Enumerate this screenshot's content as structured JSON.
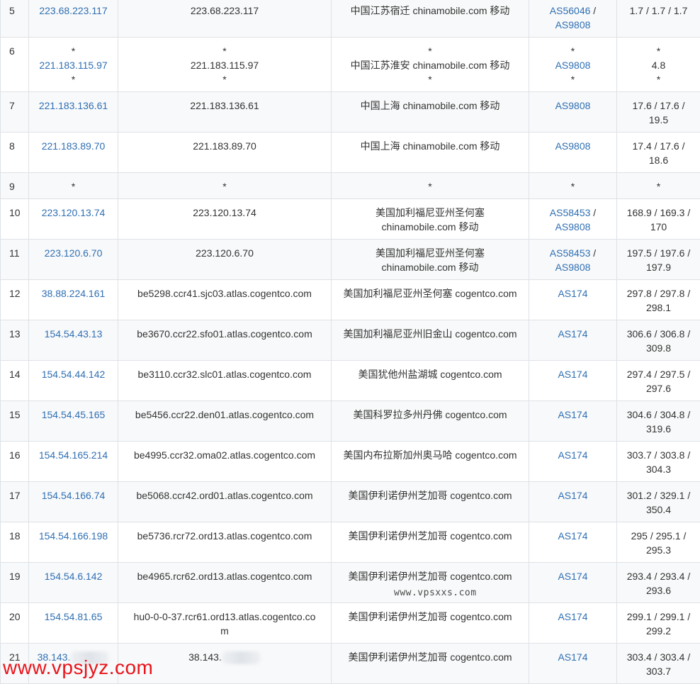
{
  "rows": [
    {
      "num": "5",
      "ip": "223.68.223.117",
      "host": "223.68.223.117",
      "geo": "中国江苏宿迁 chinamobile.com 移动",
      "as": [
        "AS56046",
        "AS9808"
      ],
      "rtt": "1.7 / 1.7 / 1.7"
    },
    {
      "num": "6",
      "ip": "221.183.115.97",
      "host": "221.183.115.97",
      "geo": "中国江苏淮安 chinamobile.com 移动",
      "as": [
        "AS9808"
      ],
      "rtt": "4.8"
    },
    {
      "num": "7",
      "ip": "221.183.136.61",
      "host": "221.183.136.61",
      "geo": "中国上海 chinamobile.com 移动",
      "as": [
        "AS9808"
      ],
      "rtt": "17.6 / 17.6 / 19.5"
    },
    {
      "num": "8",
      "ip": "221.183.89.70",
      "host": "221.183.89.70",
      "geo": "中国上海 chinamobile.com 移动",
      "as": [
        "AS9808"
      ],
      "rtt": "17.4 / 17.6 / 18.6"
    },
    {
      "num": "9",
      "ip": "*",
      "host": "*",
      "geo": "*",
      "as": [
        "*"
      ],
      "rtt": "*"
    },
    {
      "num": "10",
      "ip": "223.120.13.74",
      "host": "223.120.13.74",
      "geo": "美国加利福尼亚州圣何塞 chinamobile.com 移动",
      "as": [
        "AS58453",
        "AS9808"
      ],
      "rtt": "168.9 / 169.3 / 170"
    },
    {
      "num": "11",
      "ip": "223.120.6.70",
      "host": "223.120.6.70",
      "geo": "美国加利福尼亚州圣何塞 chinamobile.com 移动",
      "as": [
        "AS58453",
        "AS9808"
      ],
      "rtt": "197.5 / 197.6 / 197.9"
    },
    {
      "num": "12",
      "ip": "38.88.224.161",
      "host": "be5298.ccr41.sjc03.atlas.cogentco.com",
      "geo": "美国加利福尼亚州圣何塞 cogentco.com",
      "as": [
        "AS174"
      ],
      "rtt": "297.8 / 297.8 / 298.1"
    },
    {
      "num": "13",
      "ip": "154.54.43.13",
      "host": "be3670.ccr22.sfo01.atlas.cogentco.com",
      "geo": "美国加利福尼亚州旧金山 cogentco.com",
      "as": [
        "AS174"
      ],
      "rtt": "306.6 / 306.8 / 309.8"
    },
    {
      "num": "14",
      "ip": "154.54.44.142",
      "host": "be3110.ccr32.slc01.atlas.cogentco.com",
      "geo": "美国犹他州盐湖城 cogentco.com",
      "as": [
        "AS174"
      ],
      "rtt": "297.4 / 297.5 / 297.6"
    },
    {
      "num": "15",
      "ip": "154.54.45.165",
      "host": "be5456.ccr22.den01.atlas.cogentco.com",
      "geo": "美国科罗拉多州丹佛 cogentco.com",
      "as": [
        "AS174"
      ],
      "rtt": "304.6 / 304.8 / 319.6"
    },
    {
      "num": "16",
      "ip": "154.54.165.214",
      "host": "be4995.ccr32.oma02.atlas.cogentco.com",
      "geo": "美国内布拉斯加州奥马哈 cogentco.com",
      "as": [
        "AS174"
      ],
      "rtt": "303.7 / 303.8 / 304.3"
    },
    {
      "num": "17",
      "ip": "154.54.166.74",
      "host": "be5068.ccr42.ord01.atlas.cogentco.com",
      "geo": "美国伊利诺伊州芝加哥 cogentco.com",
      "as": [
        "AS174"
      ],
      "rtt": "301.2 / 329.1 / 350.4"
    },
    {
      "num": "18",
      "ip": "154.54.166.198",
      "host": "be5736.rcr72.ord13.atlas.cogentco.com",
      "geo": "美国伊利诺伊州芝加哥 cogentco.com",
      "as": [
        "AS174"
      ],
      "rtt": "295 / 295.1 / 295.3"
    },
    {
      "num": "19",
      "ip": "154.54.6.142",
      "host": "be4965.rcr62.ord13.atlas.cogentco.com",
      "geo": "美国伊利诺伊州芝加哥 cogentco.com",
      "as": [
        "AS174"
      ],
      "rtt": "293.4 / 293.4 / 293.6"
    },
    {
      "num": "20",
      "ip": "154.54.81.65",
      "host": "hu0-0-0-37.rcr61.ord13.atlas.cogentco.com",
      "geo": "美国伊利诺伊州芝加哥 cogentco.com",
      "as": [
        "AS174"
      ],
      "rtt": "299.1 / 299.1 / 299.2"
    },
    {
      "num": "21",
      "ip": "38.143.",
      "host": "38.143.",
      "geo": "美国伊利诺伊州芝加哥 cogentco.com",
      "as": [
        "AS174"
      ],
      "rtt": "303.4 / 303.4 / 303.7"
    }
  ],
  "watermark_center": "www.vpsxxs.com",
  "watermark_corner": "www.vpsjyz.com"
}
